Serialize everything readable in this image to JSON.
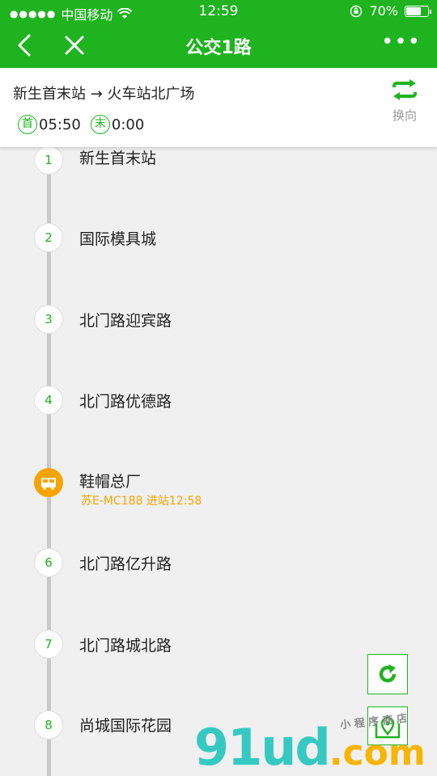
{
  "status_bar": {
    "carrier": "中国移动",
    "time": "12:59",
    "battery_percent": "70%",
    "battery_level": 0.7
  },
  "nav": {
    "title": "公交1路"
  },
  "route": {
    "direction_text": "新生首末站 → 火车站北广场",
    "first_label": "首",
    "first_time": "05:50",
    "last_label": "末",
    "last_time": "0:00",
    "switch_label": "换向"
  },
  "stops": [
    {
      "number": "1",
      "name": "新生首末站"
    },
    {
      "number": "2",
      "name": "国际模具城"
    },
    {
      "number": "3",
      "name": "北门路迎宾路"
    },
    {
      "number": "4",
      "name": "北门路优德路"
    },
    {
      "number": "",
      "name": "鞋帽总厂",
      "bus": true,
      "arrival": "苏E-MC188 进站12:58"
    },
    {
      "number": "6",
      "name": "北门路亿升路"
    },
    {
      "number": "7",
      "name": "北门路城北路"
    },
    {
      "number": "8",
      "name": "尚城国际花园"
    }
  ],
  "watermark": {
    "brand_a": "91ud",
    "brand_b": ".com",
    "caption": "小 程 序 商 店"
  },
  "colors": {
    "brand": "#1fb31f",
    "bus": "#f7a300"
  }
}
